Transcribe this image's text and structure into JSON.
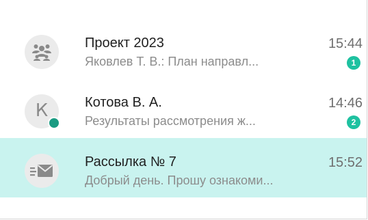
{
  "chats": [
    {
      "title": "Проект 2023",
      "time": "15:44",
      "preview": "Яковлев Т. В.: План направл...",
      "unread": "1",
      "avatar_icon": "group-icon"
    },
    {
      "title": "Котова В. А.",
      "time": "14:46",
      "preview": "Результаты рассмотрения ж...",
      "unread": "2",
      "avatar_letter": "К",
      "online": true
    },
    {
      "title": "Рассылка № 7",
      "time": "15:52",
      "preview": "Добрый день. Прошу ознакоми...",
      "avatar_icon": "mailing-icon",
      "selected": true
    }
  ],
  "colors": {
    "accent": "#1ec1a0",
    "online": "#1a9b82",
    "selected_bg": "#c9f3ef",
    "avatar_bg": "#ebebeb"
  }
}
